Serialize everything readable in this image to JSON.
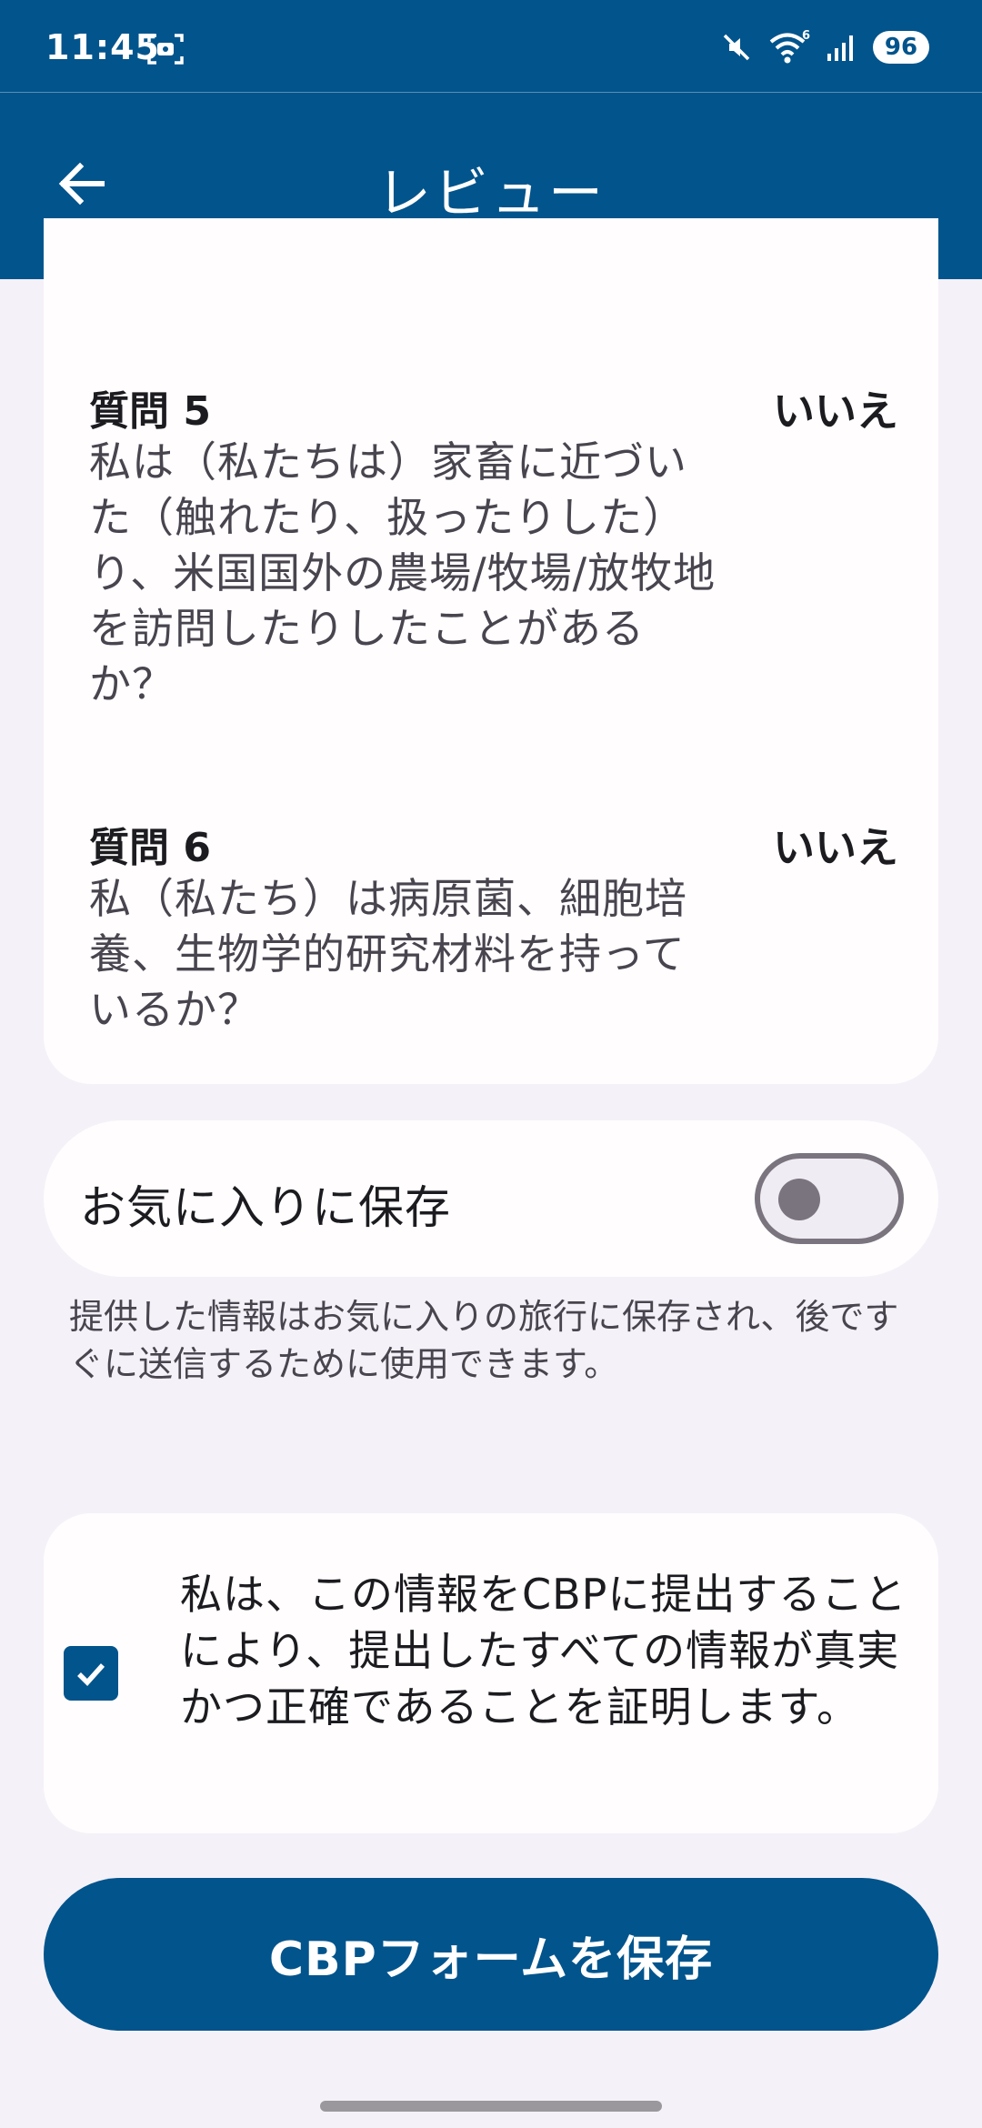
{
  "status_bar": {
    "time": "11:45",
    "battery": "96",
    "icons": [
      "screenshot-icon",
      "mute-icon",
      "wifi-icon",
      "signal-icon"
    ]
  },
  "app_bar": {
    "title": "レビュー",
    "back_icon": "arrow-left-icon"
  },
  "questions": [
    {
      "label": "質問 5",
      "answer": "いいえ",
      "text": "私は（私たちは）家畜に近づいた（触れたり、扱ったりした）り、米国国外の農場/牧場/放牧地を訪問したりしたことがあるか？"
    },
    {
      "label": "質問 6",
      "answer": "いいえ",
      "text": "私（私たち）は病原菌、細胞培養、生物学的研究材料を持っているか？"
    }
  ],
  "favorite": {
    "label": "お気に入りに保存",
    "enabled": false,
    "note": "提供した情報はお気に入りの旅行に保存され、後ですぐに送信するために使用できます。"
  },
  "certify": {
    "checked": true,
    "text": "私は、この情報をCBPに提出することにより、提出したすべての情報が真実かつ正確であることを証明します。"
  },
  "save_button": {
    "label": "CBPフォームを保存"
  },
  "colors": {
    "primary": "#01548c",
    "background": "#f5f1f8",
    "card": "#fffdfe",
    "toggle_outline": "#79747e"
  }
}
